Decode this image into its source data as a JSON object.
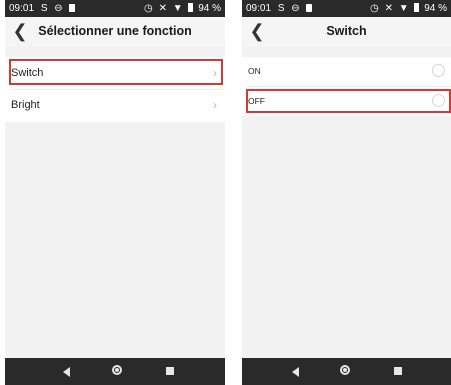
{
  "screens": [
    {
      "status_bar": {
        "time": "09:01",
        "left_icons": [
          "S",
          "⊖"
        ],
        "right_icons": [
          "◷",
          "✕",
          "▼"
        ],
        "battery": "94 %"
      },
      "header": {
        "back_icon": "back-chevron-icon",
        "title": "Sélectionner une fonction"
      },
      "items": [
        {
          "label": "Switch",
          "trailing": "›",
          "highlighted": true
        },
        {
          "label": "Bright",
          "trailing": "›",
          "highlighted": false
        }
      ]
    },
    {
      "status_bar": {
        "time": "09:01",
        "left_icons": [
          "S",
          "⊖"
        ],
        "right_icons": [
          "◷",
          "✕",
          "▼"
        ],
        "battery": "94 %"
      },
      "header": {
        "back_icon": "back-chevron-icon",
        "title": "Switch"
      },
      "options": [
        {
          "label": "ON",
          "selected": false,
          "highlighted": false
        },
        {
          "label": "OFF",
          "selected": false,
          "highlighted": true
        }
      ]
    }
  ],
  "colors": {
    "highlight": "#d23a3a",
    "system_bar": "#2a2a2a",
    "background": "#f2f2f2"
  }
}
